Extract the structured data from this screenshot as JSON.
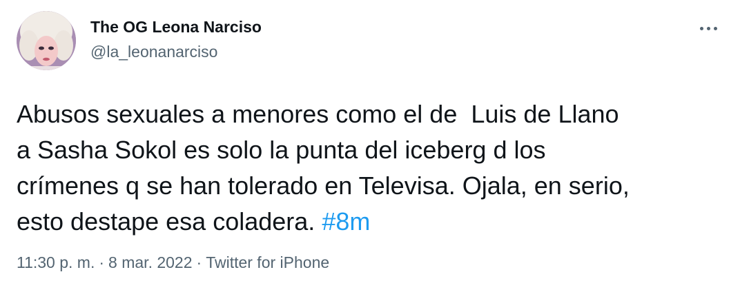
{
  "author": {
    "display_name": "The OG Leona Narciso",
    "handle": "@la_leonanarciso",
    "avatar_icon": "profile-photo"
  },
  "menu": {
    "more_icon": "more-horizontal-icon"
  },
  "tweet": {
    "lines": [
      "Abusos sexuales a menores como el de  Luis de Llano",
      "a Sasha Sokol es solo la punta del iceberg d los",
      "crímenes q se han tolerado en Televisa. Ojala, en serio,",
      "esto destape esa coladera. "
    ],
    "hashtag": "#8m"
  },
  "meta": {
    "time": "11:30 p. m.",
    "separator": "·",
    "date": "8 mar. 2022",
    "source": "Twitter for iPhone"
  },
  "colors": {
    "text": "#0f1419",
    "secondary": "#536471",
    "link": "#1d9bf0"
  }
}
